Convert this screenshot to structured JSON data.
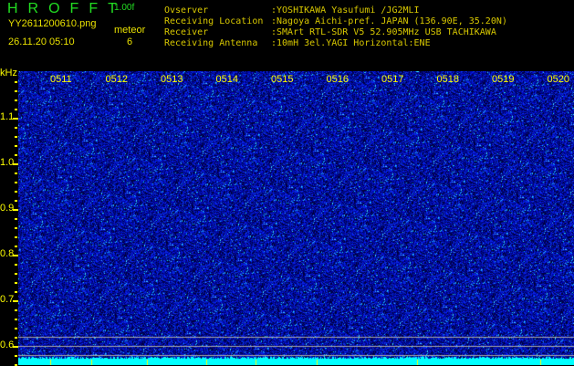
{
  "header": {
    "title": "HROFFT",
    "version": "1.00f",
    "filename": "YY2611200610.png",
    "datetime": "26.11.20 05:10",
    "meteor_label": "meteor",
    "meteor_count": "6"
  },
  "info": [
    {
      "label": "Ovserver",
      "value": ":YOSHIKAWA Yasufumi /JG2MLI"
    },
    {
      "label": "Receiving Location",
      "value": ":Nagoya Aichi-pref. JAPAN (136.90E, 35.20N)"
    },
    {
      "label": "Receiver",
      "value": ":SMArt RTL-SDR V5 52.905MHz USB TACHIKAWA"
    },
    {
      "label": "Receiving Antenna",
      "value": ":10mH 3el.YAGI Horizontal:ENE"
    }
  ],
  "y_axis": {
    "unit": "kHz",
    "ticks": [
      "1.1",
      "1.0",
      "0.9",
      "0.8",
      "0.7",
      "0.6"
    ]
  },
  "time_labels": [
    "0511",
    "0512",
    "0513",
    "0514",
    "0515",
    "0516",
    "0517",
    "0518",
    "0519",
    "0520"
  ],
  "colors": {
    "noise": "#1020d0",
    "baseline": "#00ffff",
    "marker": "#ffff00"
  }
}
